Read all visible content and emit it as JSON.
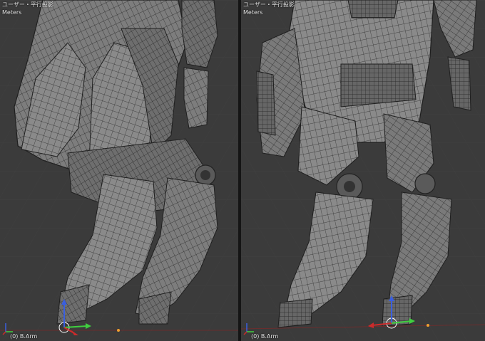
{
  "viewports": [
    {
      "view_label": "ユーザー・平行投影",
      "units_label": "Meters",
      "object_label": "(0) B.Arm"
    },
    {
      "view_label": "ユーザー・平行投影",
      "units_label": "Meters",
      "object_label": "(0) B.Arm"
    }
  ],
  "colors": {
    "background": "#3b3b3b",
    "grid": "#454545",
    "mesh_fill": "#8c8c8c",
    "mesh_dark": "#5e5e5e",
    "wire": "#222222",
    "axis_x": "#cc2b2b",
    "axis_y": "#3fcf3f",
    "axis_z": "#3a5fe0"
  },
  "icons": [
    "axis-gizmo-icon",
    "3d-cursor-icon",
    "origin-dot-icon"
  ]
}
